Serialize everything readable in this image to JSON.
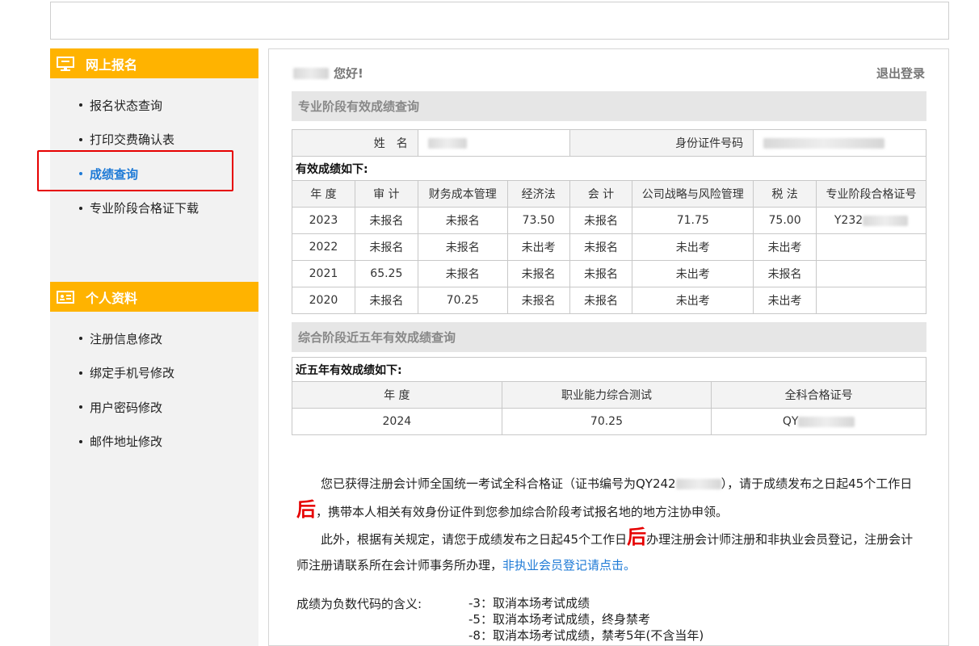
{
  "sidebar": {
    "section1_title": "网上报名",
    "section1_items": [
      "报名状态查询",
      "打印交费确认表",
      "成绩查询",
      "专业阶段合格证下载"
    ],
    "section2_title": "个人资料",
    "section2_items": [
      "注册信息修改",
      "绑定手机号修改",
      "用户密码修改",
      "邮件地址修改"
    ]
  },
  "main": {
    "greeting": "您好!",
    "logout": "退出登录",
    "section1_title": "专业阶段有效成绩查询",
    "name_label": "姓　名",
    "id_label": "身份证件号码",
    "valid_scores_caption": "有效成绩如下:",
    "score_headers": [
      "年 度",
      "审 计",
      "财务成本管理",
      "经济法",
      "会 计",
      "公司战略与风险管理",
      "税 法",
      "专业阶段合格证号"
    ],
    "score_rows": [
      [
        "2023",
        "未报名",
        "未报名",
        "73.50",
        "未报名",
        "71.75",
        "75.00",
        "Y232"
      ],
      [
        "2022",
        "未报名",
        "未报名",
        "未出考",
        "未报名",
        "未出考",
        "未出考",
        ""
      ],
      [
        "2021",
        "65.25",
        "未报名",
        "未报名",
        "未报名",
        "未出考",
        "未报名",
        ""
      ],
      [
        "2020",
        "未报名",
        "70.25",
        "未报名",
        "未报名",
        "未出考",
        "未出考",
        ""
      ]
    ],
    "section2_title": "综合阶段近五年有效成绩查询",
    "five_year_caption": "近五年有效成绩如下:",
    "comp_headers": [
      "年 度",
      "职业能力综合测试",
      "全科合格证号"
    ],
    "comp_rows": [
      [
        "2024",
        "70.25",
        "QY"
      ]
    ],
    "note1_pre": "您已获得注册会计师全国统一考试全科合格证（证书编号为QY242",
    "note1_mid": "），请于成绩发布之日起45个工作日",
    "note1_big": "后",
    "note1_post": "，携带本人相关有效身份证件到您参加综合阶段考试报名地的地方注协申领。",
    "note2_pre": "此外，根据有关规定，请您于成绩发布之日起45个工作日",
    "note2_big": "后",
    "note2_post": "办理注册会计师注册和非执业会员登记，注册会计师注册请联系所在会计师事务所办理，",
    "note2_link": "非执业会员登记请点击。",
    "codes_label": "成绩为负数代码的含义:",
    "codes": [
      "-3：取消本场考试成绩",
      "-5：取消本场考试成绩，终身禁考",
      "-8：取消本场考试成绩，禁考5年(不含当年)"
    ]
  }
}
